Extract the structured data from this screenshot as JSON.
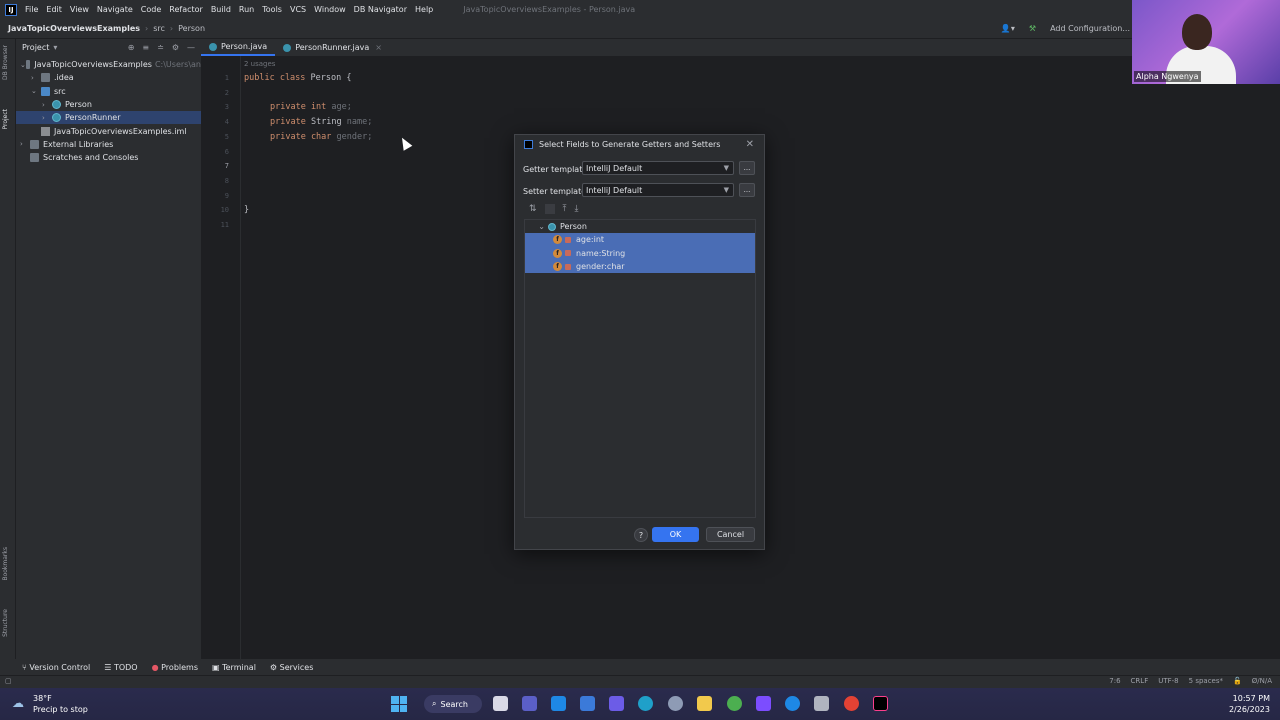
{
  "menubar": {
    "items": [
      "File",
      "Edit",
      "View",
      "Navigate",
      "Code",
      "Refactor",
      "Build",
      "Run",
      "Tools",
      "VCS",
      "Window",
      "DB Navigator",
      "Help"
    ],
    "window_title": "JavaTopicOverviewsExamples - Person.java"
  },
  "navbar": {
    "project": "JavaTopicOverviewsExamples",
    "folder": "src",
    "file": "Person",
    "run_config": "Add Configuration..."
  },
  "left_stripe": {
    "top_label": "DB Browser",
    "project_label": "Project",
    "bookmarks_label": "Bookmarks",
    "structure_label": "Structure"
  },
  "project_panel": {
    "header": "Project",
    "tree": [
      {
        "label": "JavaTopicOverviewsExamples",
        "extra": "C:\\Users\\an",
        "indent": 0,
        "arrow": "⌄",
        "icon": "folder"
      },
      {
        "label": ".idea",
        "indent": 1,
        "arrow": "›",
        "icon": "folder"
      },
      {
        "label": "src",
        "indent": 1,
        "arrow": "⌄",
        "icon": "folder src"
      },
      {
        "label": "Person",
        "indent": 2,
        "arrow": "›",
        "icon": "cls"
      },
      {
        "label": "PersonRunner",
        "indent": 2,
        "arrow": "›",
        "icon": "cls",
        "selected": true
      },
      {
        "label": "JavaTopicOverviewsExamples.iml",
        "indent": 1,
        "arrow": "",
        "icon": "file"
      },
      {
        "label": "External Libraries",
        "indent": 0,
        "arrow": "›",
        "icon": "folder"
      },
      {
        "label": "Scratches and Consoles",
        "indent": 0,
        "arrow": "",
        "icon": "folder"
      }
    ]
  },
  "tabs": [
    {
      "label": "Person.java",
      "active": true
    },
    {
      "label": "PersonRunner.java",
      "active": false
    }
  ],
  "editor": {
    "usages": "2 usages",
    "lines": [
      "1",
      "2",
      "3",
      "4",
      "5",
      "6",
      "7",
      "8",
      "9",
      "10",
      "11"
    ],
    "code": {
      "line1_kw": "public class ",
      "line1_rest": "Person {",
      "age_kw": "private int ",
      "age_name": "age;",
      "name_kw": "private ",
      "name_type": "String ",
      "name_name": "name;",
      "gender_kw": "private char ",
      "gender_name": "gender;",
      "closing": "}"
    }
  },
  "dialog": {
    "title": "Select Fields to Generate Getters and Setters",
    "getter_label": "Getter template:",
    "getter_value": "IntelliJ Default",
    "setter_label": "Setter template:",
    "setter_value": "IntelliJ Default",
    "dots": "...",
    "class_node": "Person",
    "fields": [
      "age:int",
      "name:String",
      "gender:char"
    ],
    "help": "?",
    "ok": "OK",
    "cancel": "Cancel"
  },
  "bottom_tools": [
    "Version Control",
    "TODO",
    "Problems",
    "Terminal",
    "Services"
  ],
  "statusbar": {
    "position": "7:6",
    "line_sep": "CRLF",
    "encoding": "UTF-8",
    "indent": "5 spaces*",
    "vcs": "Ø/N/A"
  },
  "taskbar": {
    "temp": "38°F",
    "weather": "Precip to stop",
    "search": "Search",
    "time": "10:57 PM",
    "date": "2/26/2023"
  },
  "webcam": {
    "name": "Alpha Ngwenya"
  }
}
